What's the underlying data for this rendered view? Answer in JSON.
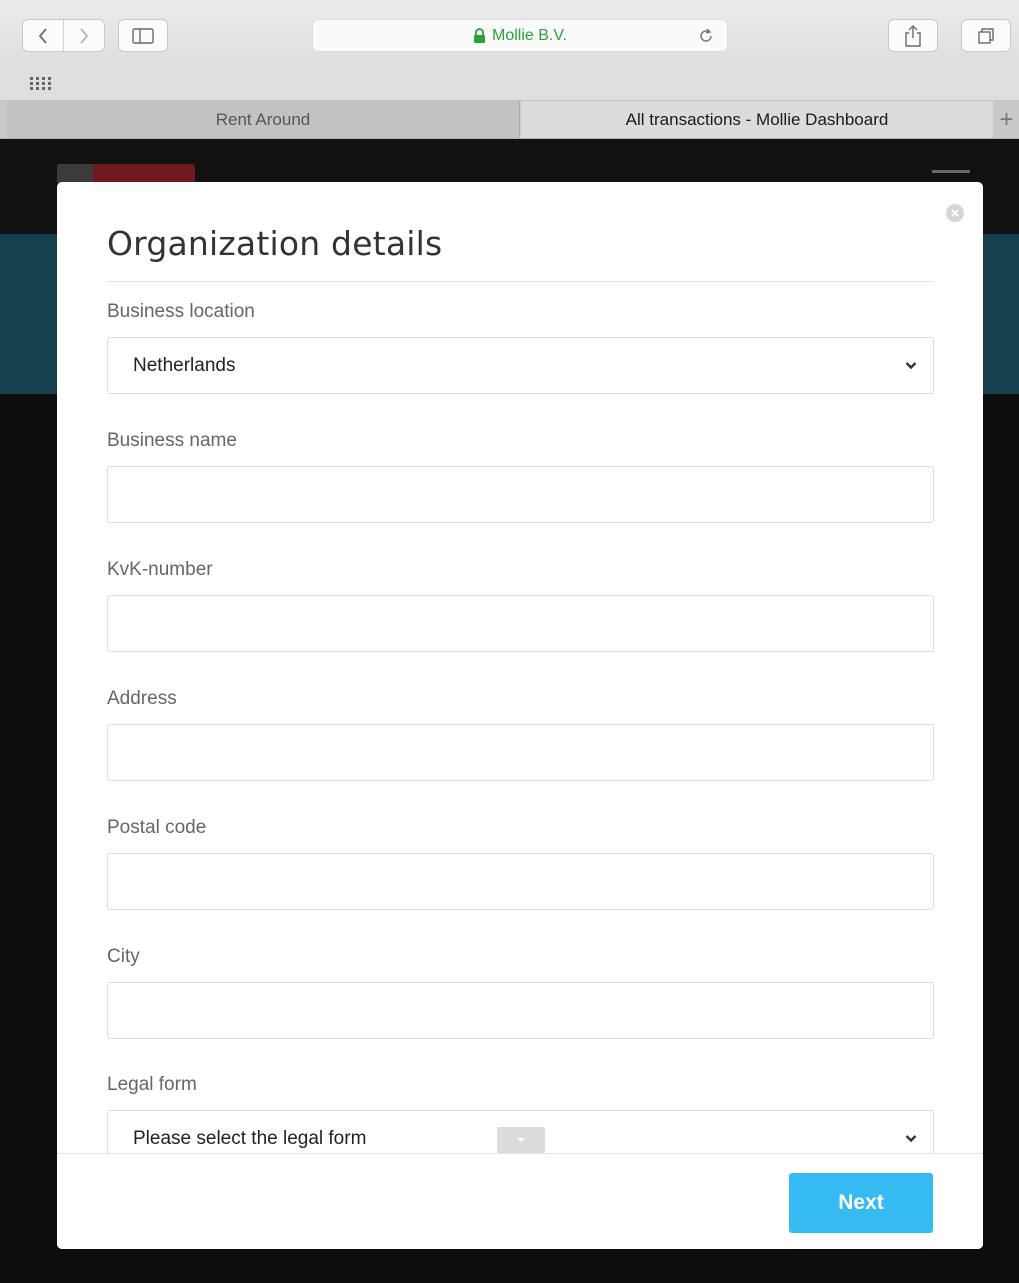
{
  "browser": {
    "address": "Mollie B.V.",
    "tabs": [
      {
        "label": "Rent Around",
        "active": false
      },
      {
        "label": "All transactions - Mollie Dashboard",
        "active": true
      }
    ],
    "new_tab_label": "+"
  },
  "modal": {
    "title": "Organization details",
    "fields": {
      "business_location": {
        "label": "Business location",
        "value": "Netherlands"
      },
      "business_name": {
        "label": "Business name",
        "value": ""
      },
      "kvk_number": {
        "label": "KvK-number",
        "value": ""
      },
      "address": {
        "label": "Address",
        "value": ""
      },
      "postal_code": {
        "label": "Postal code",
        "value": ""
      },
      "city": {
        "label": "City",
        "value": ""
      },
      "legal_form": {
        "label": "Legal form",
        "value": "Please select the legal form"
      }
    },
    "next_label": "Next"
  },
  "colors": {
    "secure_green": "#2aa33a",
    "primary_button": "#35bbf1",
    "background_band": "#15414f"
  }
}
